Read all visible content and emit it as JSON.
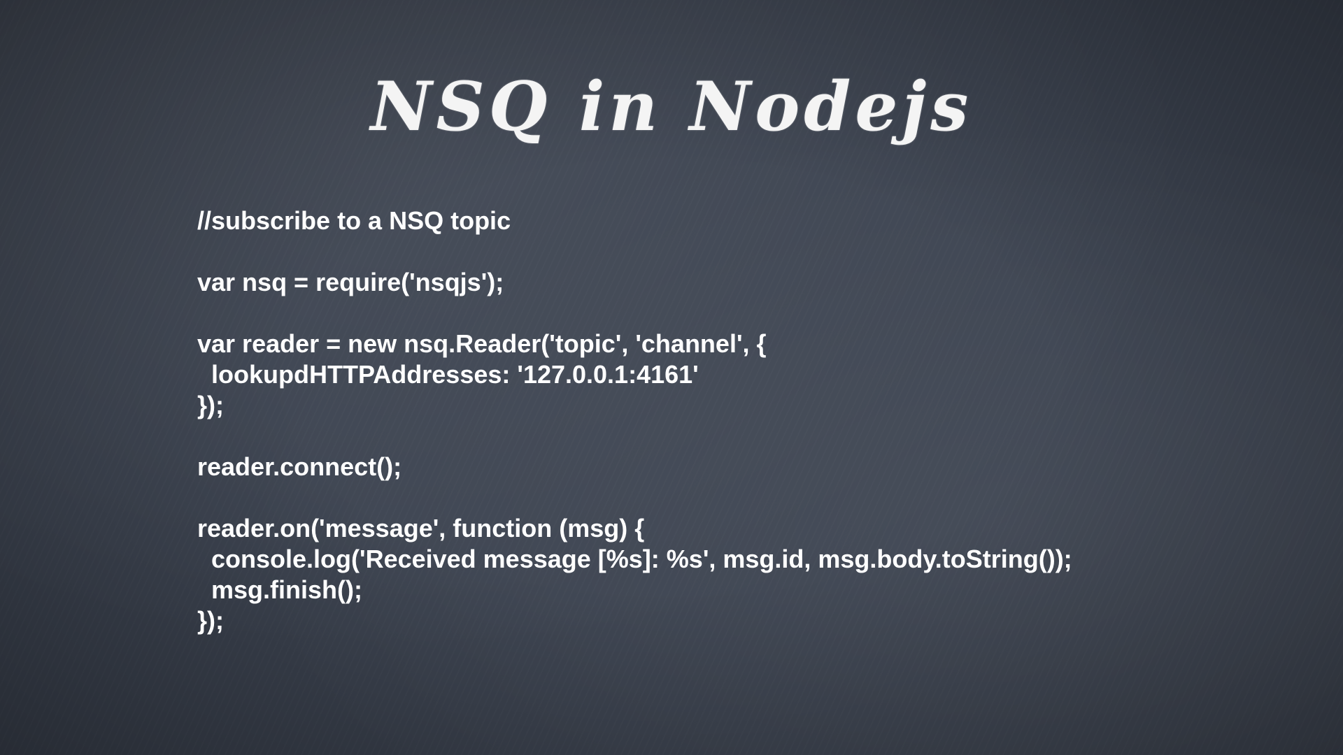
{
  "slide": {
    "title": "NSQ in Nodejs",
    "code_lines": [
      "//subscribe to a NSQ topic",
      "",
      "var nsq = require('nsqjs');",
      "",
      "var reader = new nsq.Reader('topic', 'channel', {",
      "  lookupdHTTPAddresses: '127.0.0.1:4161'",
      "});",
      "",
      "reader.connect();",
      "",
      "reader.on('message', function (msg) {",
      "  console.log('Received message [%s]: %s', msg.id, msg.body.toString());",
      "  msg.finish();",
      "});"
    ]
  },
  "colors": {
    "background": "#3c4350",
    "text": "#ffffff"
  }
}
